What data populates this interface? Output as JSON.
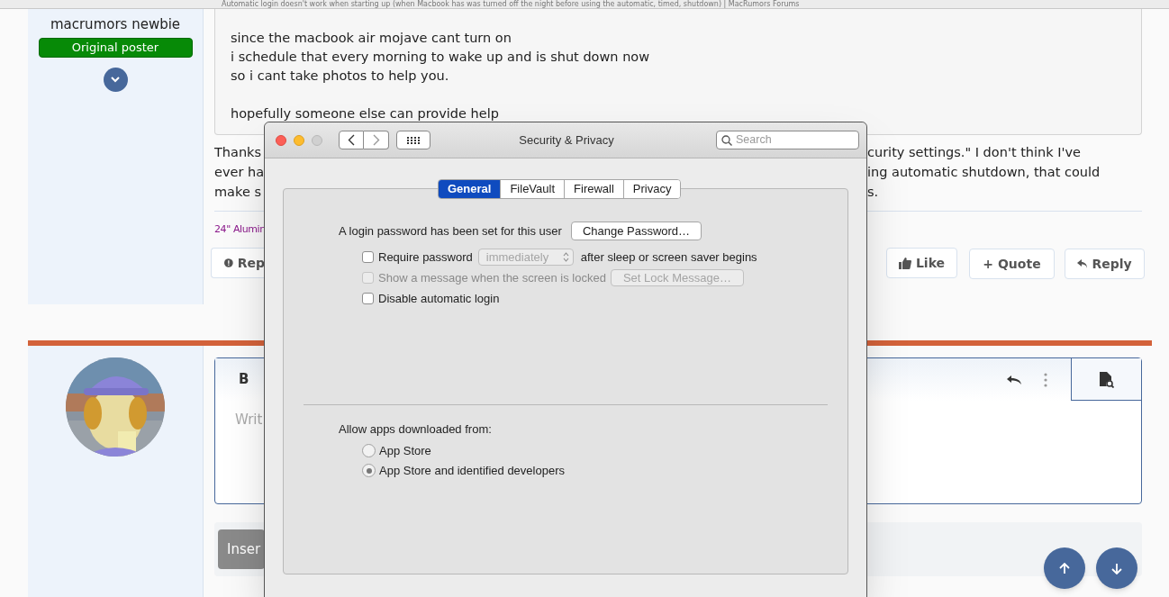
{
  "browser_tab_title": "Automatic login doesn't work when starting up (when Macbook has was turned off the night before using the automatic, timed, shutdown) | MacRumors Forums",
  "post_author": {
    "rank": "macrumors newbie",
    "badge": "Original poster"
  },
  "quote": {
    "lines": [
      "since the macbook air mojave cant turn on",
      "i schedule that every morning to wake up and is shut down now",
      "so i cant take photos to help you."
    ],
    "closing_line": "hopefully someone else can provide help"
  },
  "post": {
    "lines": [
      {
        "left": "Thanks",
        "right": "curity settings.\" I don't think I've"
      },
      {
        "left": "ever ha",
        "right": "ing automatic shutdown, that could"
      },
      {
        "left": "make s",
        "right": "s."
      }
    ],
    "signature": "24\" Alumin",
    "actions": [
      {
        "kind": "report",
        "label": "Rep"
      },
      {
        "kind": "like",
        "label": "Like"
      },
      {
        "kind": "quote",
        "label": "+ Quote"
      },
      {
        "kind": "reply",
        "label": "Reply"
      }
    ]
  },
  "editor": {
    "bold_button": "B",
    "placeholder": "Writ",
    "insert_button": "Inser"
  },
  "dialog": {
    "title": "Security & Privacy",
    "search_placeholder": "Search",
    "tabs": [
      {
        "label": "General",
        "selected": true
      },
      {
        "label": "FileVault",
        "selected": false
      },
      {
        "label": "Firewall",
        "selected": false
      },
      {
        "label": "Privacy",
        "selected": false
      }
    ],
    "login_text": "A login password has been set for this user",
    "change_password_button": "Change Password…",
    "options": [
      {
        "kind": "select",
        "label": "Require password",
        "checked": false,
        "disabled": false,
        "control": "immediately",
        "control_disabled": true,
        "suffix": "after sleep or screen saver begins"
      },
      {
        "kind": "button",
        "label": "Show a message when the screen is locked",
        "checked": false,
        "disabled": true,
        "control": "Set Lock Message…",
        "control_disabled": true
      },
      {
        "kind": "plain",
        "label": "Disable automatic login",
        "checked": false,
        "disabled": false
      }
    ],
    "allow_label": "Allow apps downloaded from:",
    "sources": [
      {
        "label": "App Store",
        "selected": false
      },
      {
        "label": "App Store and identified developers",
        "selected": true
      }
    ]
  }
}
